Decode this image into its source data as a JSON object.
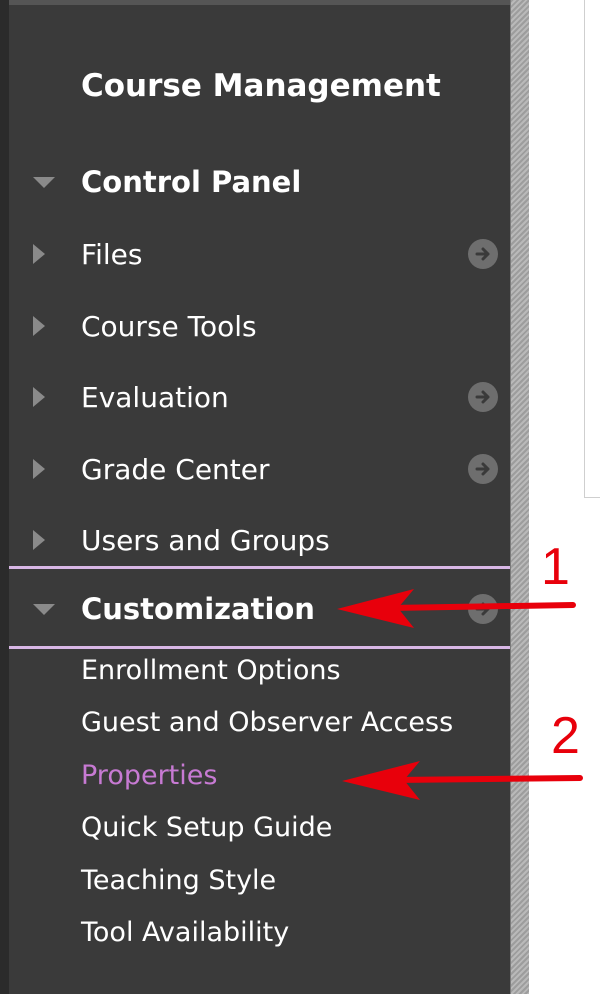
{
  "sidebar": {
    "heading": "Course Management",
    "control_panel": {
      "label": "Control Panel",
      "expanded": true
    },
    "items": [
      {
        "label": "Files",
        "has_arrow": true
      },
      {
        "label": "Course Tools",
        "has_arrow": false
      },
      {
        "label": "Evaluation",
        "has_arrow": true
      },
      {
        "label": "Grade Center",
        "has_arrow": true
      },
      {
        "label": "Users and Groups",
        "has_arrow": false
      }
    ],
    "customization": {
      "label": "Customization",
      "expanded": true,
      "subitems": [
        {
          "label": "Enrollment Options",
          "active": false
        },
        {
          "label": "Guest and Observer Access",
          "active": false
        },
        {
          "label": "Properties",
          "active": true
        },
        {
          "label": "Quick Setup Guide",
          "active": false
        },
        {
          "label": "Teaching Style",
          "active": false
        },
        {
          "label": "Tool Availability",
          "active": false
        }
      ]
    }
  },
  "annotations": [
    {
      "number": "1",
      "points_to": "Customization"
    },
    {
      "number": "2",
      "points_to": "Properties"
    }
  ],
  "colors": {
    "sidebar_bg": "#3a3a3a",
    "text": "#ffffff",
    "active_link": "#c77ad3",
    "divider": "#d8b7e6",
    "annotation_red": "#e8000b",
    "icon_gray": "#8a8a8a"
  },
  "icons": {
    "collapsed": "triangle-right-icon",
    "expanded": "triangle-down-icon",
    "go": "circle-arrow-right-icon"
  }
}
